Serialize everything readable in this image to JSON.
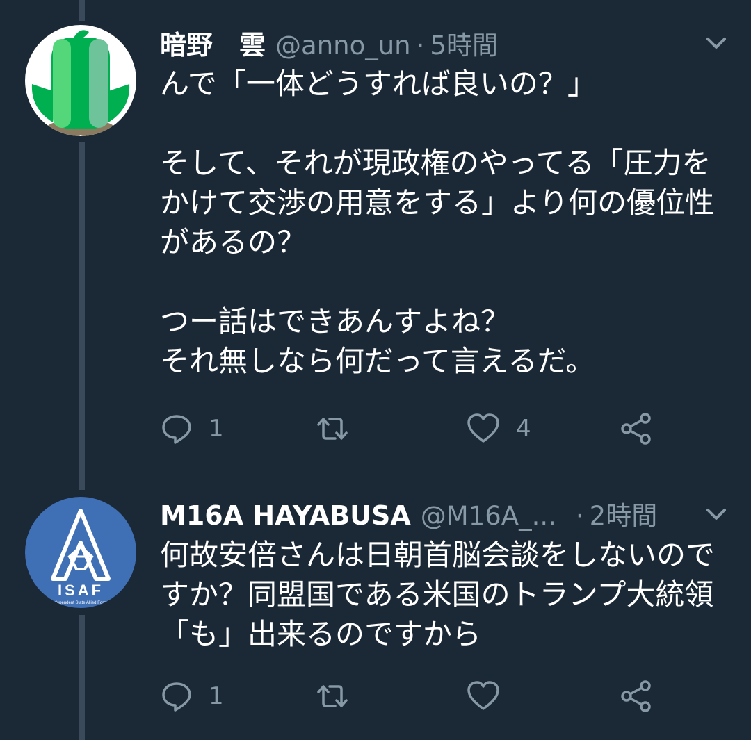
{
  "tweets": [
    {
      "name": "暗野　雲",
      "handle": "@anno_un",
      "separator": "·",
      "time": "5時間",
      "text": "んで「一体どうすれば良いの？」\n\nそして、それが現政権のやってる「圧力をかけて交渉の用意をする」より何の優位性があるの？\n\nつー話はできあんすよね？\nそれ無しなら何だって言えるだ。",
      "actions": {
        "reply_count": "1",
        "retweet_count": "",
        "like_count": "4"
      },
      "avatar": {
        "type": "green-character",
        "colors": [
          "#00b050",
          "#3fd26b",
          "#ffffff"
        ]
      }
    },
    {
      "name": "M16A HAYABUSA",
      "handle": "@M16A_...",
      "separator": "·",
      "time": "2時間",
      "text": "何故安倍さんは日朝首脳会談をしないのですか？同盟国である米国のトランプ大統領「も」出来るのですから",
      "actions": {
        "reply_count": "1",
        "retweet_count": "",
        "like_count": ""
      },
      "avatar": {
        "logo_text": "ISAF",
        "sub_text": "Independent State Allied Forces",
        "color": "#3f6fb5"
      }
    }
  ],
  "icons": [
    "reply-icon",
    "retweet-icon",
    "like-icon",
    "share-icon",
    "chevron-down-icon"
  ],
  "theme": {
    "background": "#1b2836",
    "muted": "#8899a6",
    "thread_line": "#3b4a5a"
  }
}
